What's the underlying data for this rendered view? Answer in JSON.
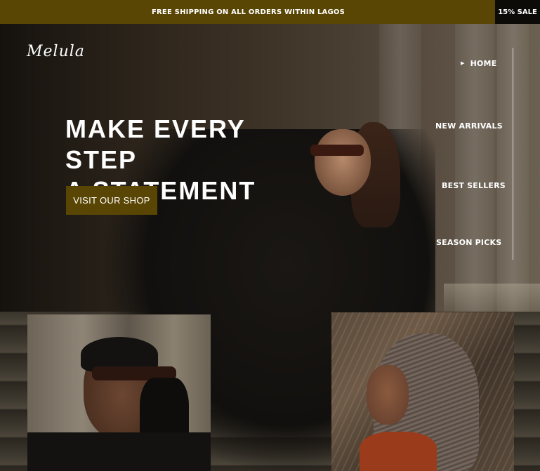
{
  "topbar": {
    "announcement": "FREE SHIPPING ON ALL ORDERS WITHIN LAGOS",
    "sale_badge": "15% SALE"
  },
  "brand": {
    "logo_text": "Melula"
  },
  "hero": {
    "headline_line1": "MAKE EVERY STEP",
    "headline_line2": "A STATEMENT",
    "cta_label": "VISIT OUR SHOP"
  },
  "nav": {
    "items": [
      {
        "label": "HOME",
        "active": true
      },
      {
        "label": "NEW ARRIVALS",
        "active": false
      },
      {
        "label": "BEST SELLERS",
        "active": false
      },
      {
        "label": "SEASON PICKS",
        "active": false
      }
    ],
    "active_icon": "triangle-right-icon"
  },
  "photos": [
    {
      "subject": "man-in-sunglasses-and-gloves"
    },
    {
      "subject": "woman-with-braids-in-grass"
    }
  ],
  "colors": {
    "accent": "#5a4604",
    "sale_badge_bg": "#0d0b08",
    "text": "#ffffff"
  }
}
